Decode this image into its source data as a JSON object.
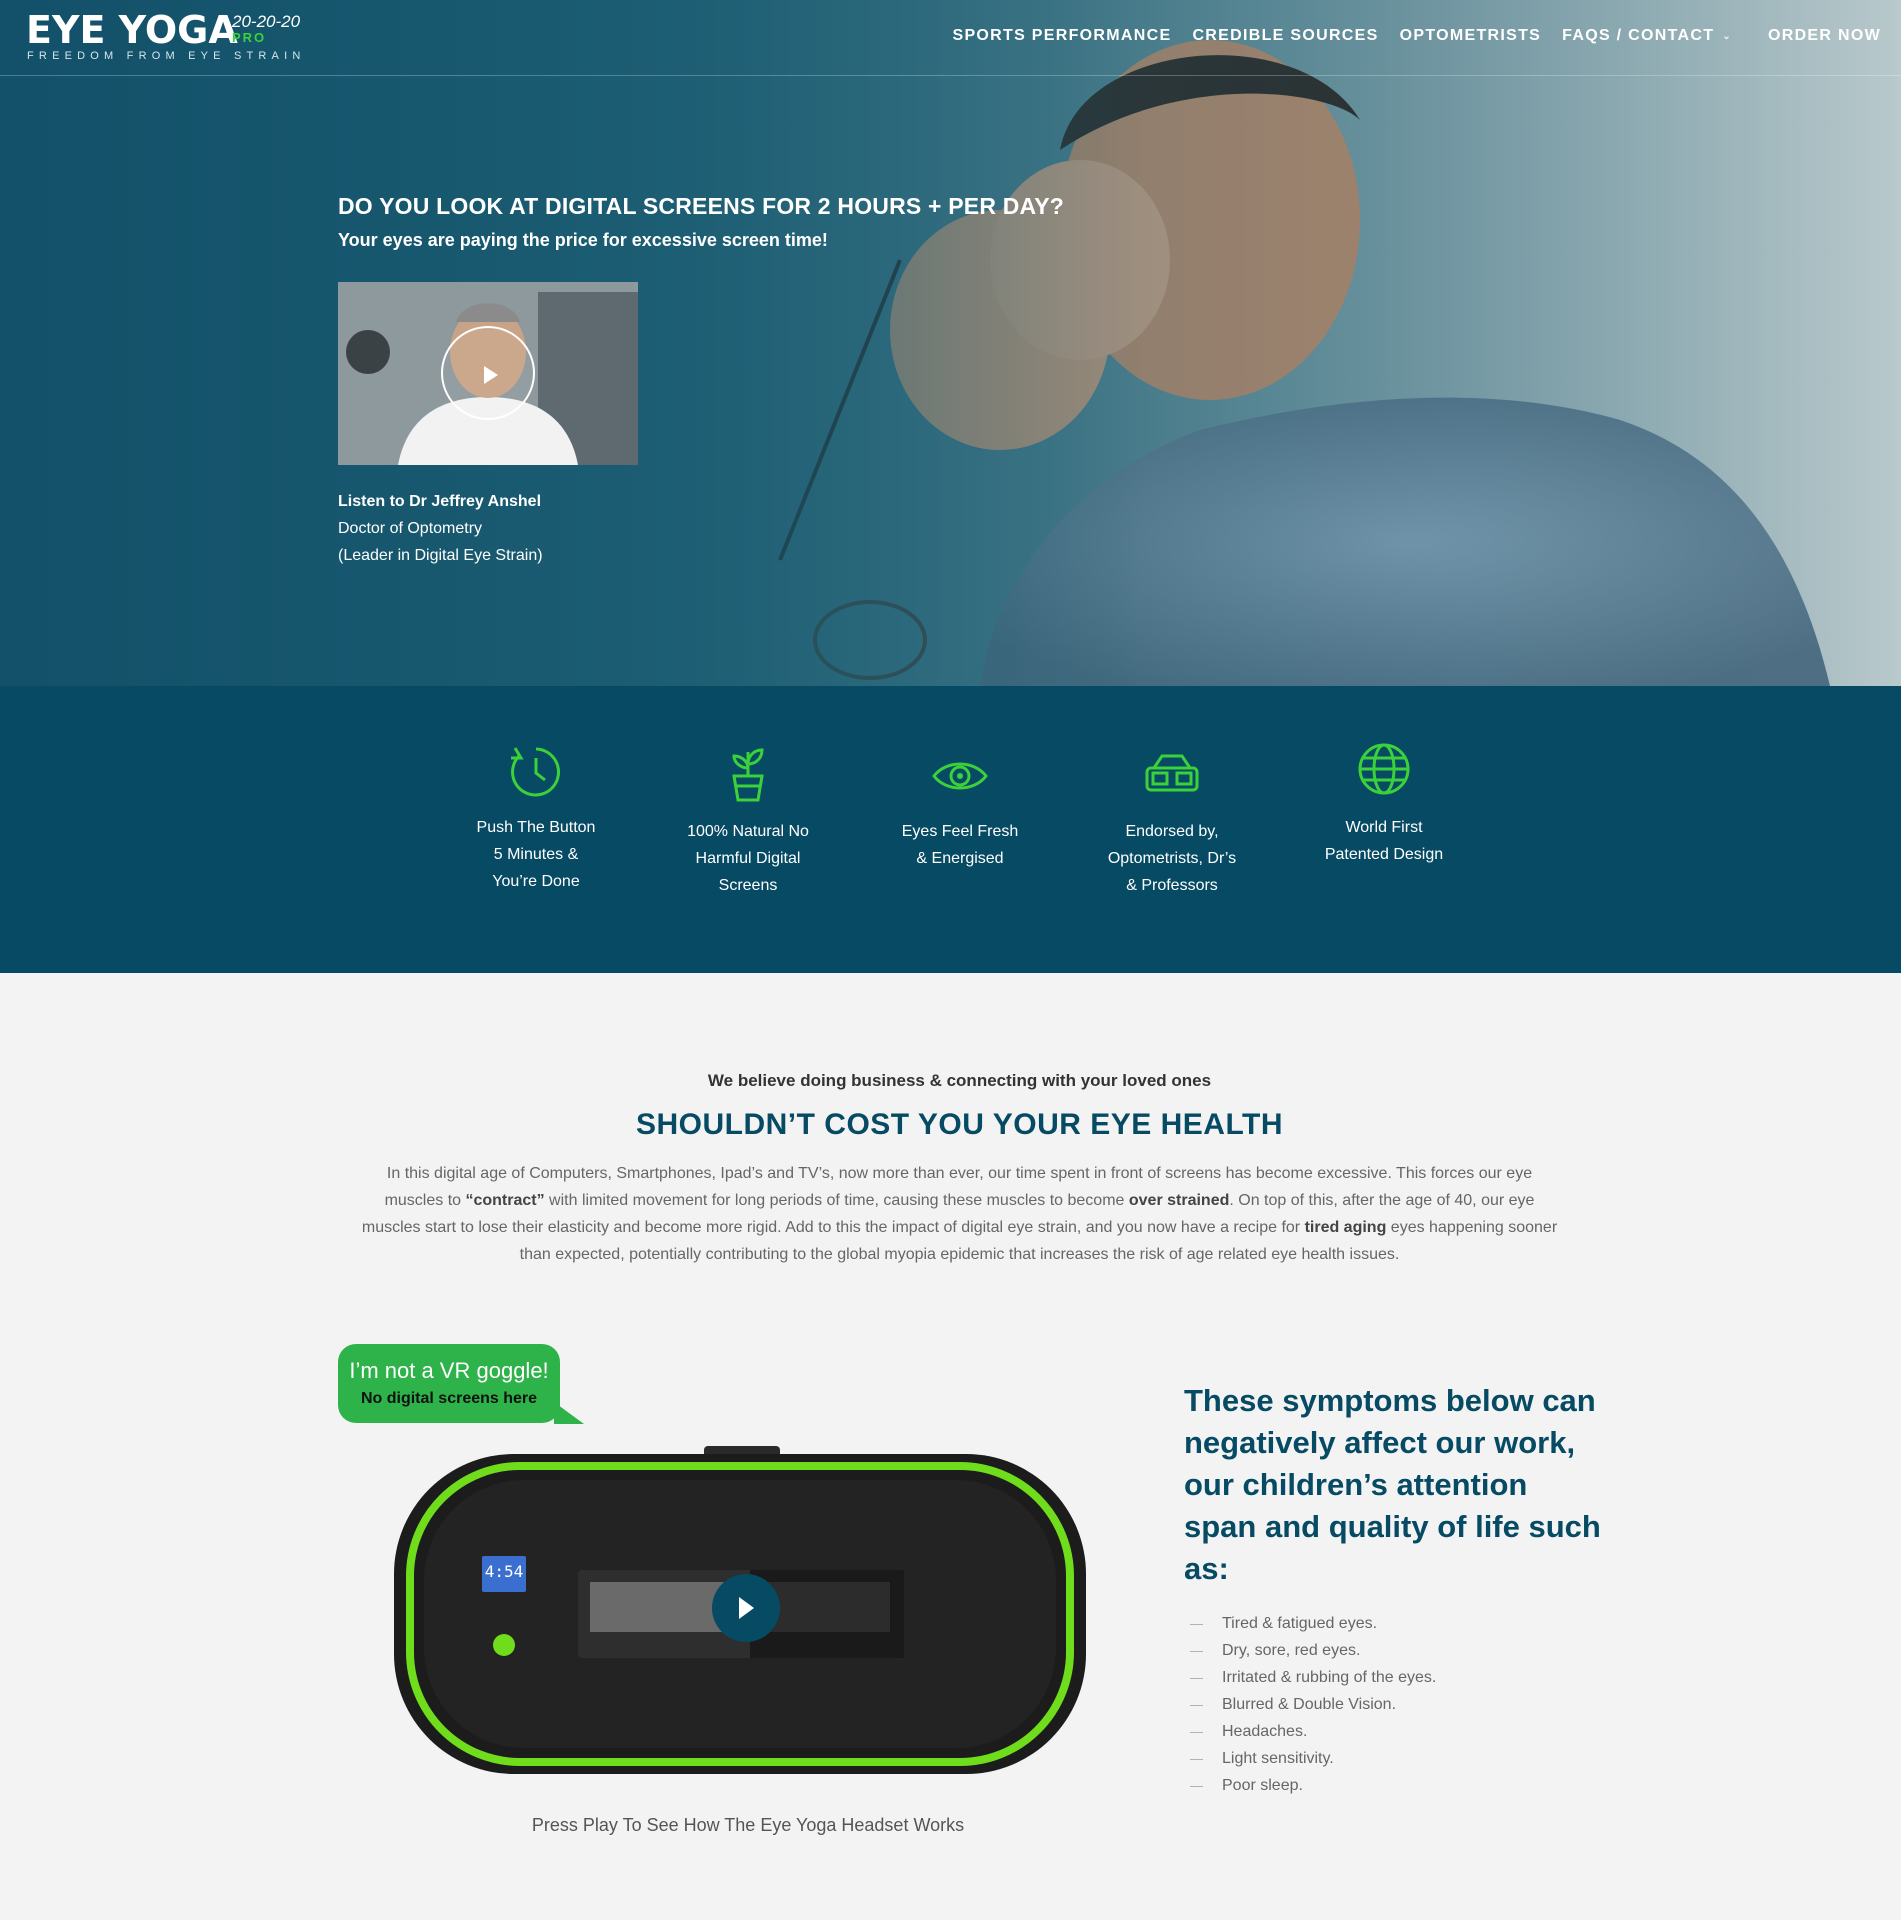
{
  "brand": {
    "name": "EYE YOGA",
    "ratio": "20-20-20",
    "pro": "PRO",
    "tagline": "FREEDOM FROM EYE STRAIN"
  },
  "nav": {
    "items": [
      {
        "label": "SPORTS PERFORMANCE"
      },
      {
        "label": "CREDIBLE SOURCES"
      },
      {
        "label": "OPTOMETRISTS"
      },
      {
        "label": "FAQS / CONTACT"
      }
    ],
    "order_label": "ORDER NOW"
  },
  "hero": {
    "title": "DO YOU LOOK AT DIGITAL SCREENS FOR 2 HOURS + PER DAY?",
    "subtitle": "Your eyes are paying the price for excessive screen time!",
    "doctor_name": "Listen to Dr Jeffrey Anshel",
    "doctor_title": "Doctor of Optometry",
    "doctor_lead": "(Leader in Digital Eye Strain)"
  },
  "features": [
    {
      "icon": "clock-icon",
      "lines": [
        "Push The Button",
        "5 Minutes &",
        "You’re Done"
      ]
    },
    {
      "icon": "plant-icon",
      "lines": [
        "100% Natural No",
        "Harmful Digital",
        "Screens"
      ]
    },
    {
      "icon": "eye-icon",
      "lines": [
        "Eyes Feel Fresh",
        "& Energised"
      ]
    },
    {
      "icon": "glasses-icon",
      "lines": [
        "Endorsed by,",
        "Optometrists, Dr’s",
        "& Professors"
      ]
    },
    {
      "icon": "globe-icon",
      "lines": [
        "World First",
        "Patented Design"
      ]
    }
  ],
  "about": {
    "kicker": "We believe doing business & connecting with your loved ones",
    "title": "SHOULDN’T COST YOU YOUR EYE HEALTH",
    "p1": "In this digital age of Computers, Smartphones, Ipad’s and TV’s, now more than ever, our time spent in front of screens has become excessive. This forces our eye muscles to ",
    "b1": "“contract”",
    "p2": " with limited movement for long periods of time, causing these muscles to become ",
    "b2": "over strained",
    "p3": ". On top of this, after the age of 40, our eye muscles start to lose their elasticity and become more rigid. Add to this the impact of digital eye strain, and you now have a recipe for ",
    "b3": "tired aging",
    "p4": " eyes happening sooner than expected, potentially contributing to the global myopia epidemic that increases the risk of age related eye health issues."
  },
  "bubble": {
    "main": "I’m not a VR goggle!",
    "sub": "No digital screens here"
  },
  "device": {
    "timer": "4:54"
  },
  "press_play": "Press Play To See How The Eye Yoga Headset Works",
  "symptoms": {
    "title": "These symptoms below can negatively affect our work, our children’s attention span and quality of life such as:",
    "items": [
      "Tired & fatigued eyes.",
      "Dry, sore, red eyes.",
      "Irritated & rubbing of the eyes.",
      "Blurred & Double Vision.",
      "Headaches.",
      "Light sensitivity.",
      "Poor sleep."
    ]
  },
  "colors": {
    "brand_dark": "#064a63",
    "accent_green": "#2db34a",
    "icon_green": "#3bd13b"
  }
}
